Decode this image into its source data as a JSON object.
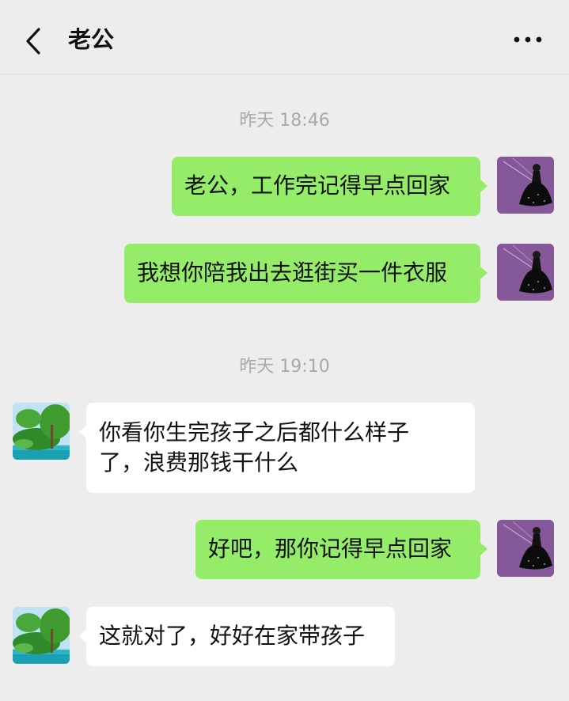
{
  "header": {
    "title": "老公"
  },
  "messages": [
    {
      "type": "time",
      "text": "昨天 18:46"
    },
    {
      "type": "sent",
      "text": "老公，工作完记得早点回家"
    },
    {
      "type": "sent",
      "text": "我想你陪我出去逛街买一件衣服"
    },
    {
      "type": "time",
      "text": "昨天 19:10"
    },
    {
      "type": "recv",
      "lines": [
        "你看你生完孩子之后都什么样子",
        "了，浪费那钱干什么"
      ]
    },
    {
      "type": "sent",
      "text": "好吧，那你记得早点回家"
    },
    {
      "type": "recv",
      "text": "这就对了，好好在家带孩子"
    }
  ],
  "colors": {
    "sent_bubble": "#95ec69",
    "recv_bubble": "#ffffff",
    "background": "#ededed",
    "timestamp": "#a9a9a9"
  },
  "icons": {
    "back": "chevron-left-icon",
    "more": "more-dots-icon"
  }
}
